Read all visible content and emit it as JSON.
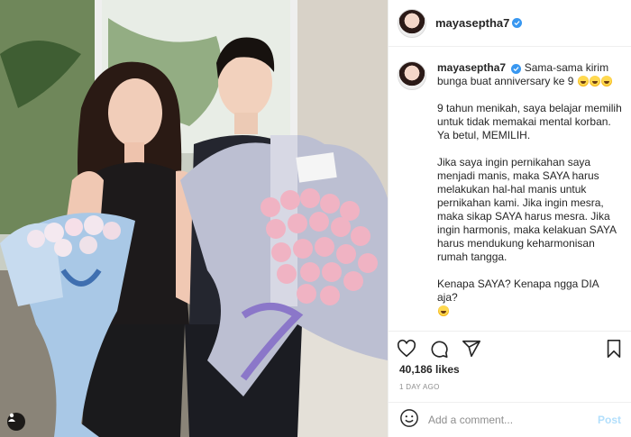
{
  "post": {
    "username": "mayaseptha7",
    "caption_intro": "Sama-sama kirim bunga buat anniversary ke 9",
    "caption_paragraphs": [
      "9 tahun menikah, saya belajar memilih untuk tidak memakai mental korban. Ya betul, MEMILIH.",
      "Jika saya ingin pernikahan saya menjadi manis, maka SAYA harus melakukan hal-hal manis untuk pernikahan kami. Jika ingin mesra, maka sikap SAYA harus mesra. Jika ingin harmonis, maka kelakuan SAYA harus mendukung keharmonisan rumah tangga.",
      "Kenapa SAYA? Kenapa ngga DIA aja?"
    ],
    "likes": "40,186 likes",
    "date": "1 DAY AGO"
  },
  "comment": {
    "placeholder": "Add a comment...",
    "post_label": "Post"
  },
  "colors": {
    "verified": "#3897f0",
    "post_button": "#b2dffc",
    "text": "#262626",
    "muted": "#8e8e8e"
  },
  "icons": [
    "verified-badge-icon",
    "heart-icon",
    "comment-icon",
    "share-icon",
    "bookmark-icon",
    "emoji-icon",
    "user-tag-icon"
  ]
}
